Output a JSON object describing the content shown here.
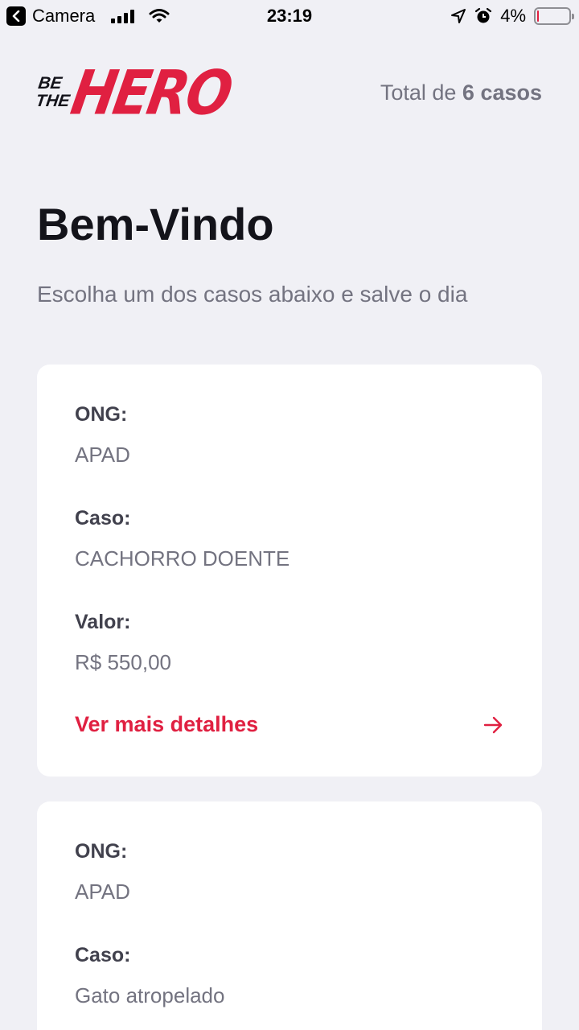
{
  "status_bar": {
    "back_app": "Camera",
    "time": "23:19",
    "battery": "4%",
    "battery_level": 0.04
  },
  "header": {
    "logo_small_top": "BE",
    "logo_small_bottom": "THE",
    "logo_big": "HERO",
    "total_prefix": "Total de ",
    "total_count": "6 casos"
  },
  "page": {
    "title": "Bem-Vindo",
    "subtitle": "Escolha um dos casos abaixo e salve o dia"
  },
  "labels": {
    "ong": "ONG:",
    "caso": "Caso:",
    "valor": "Valor:",
    "details": "Ver mais detalhes"
  },
  "incidents": [
    {
      "ong": "APAD",
      "caso": "CACHORRO DOENTE",
      "valor": "R$ 550,00"
    },
    {
      "ong": "APAD",
      "caso": "Gato atropelado"
    }
  ],
  "colors": {
    "accent": "#e02041",
    "background": "#f0f0f5",
    "text_dark": "#41414d",
    "text_muted": "#737380"
  }
}
